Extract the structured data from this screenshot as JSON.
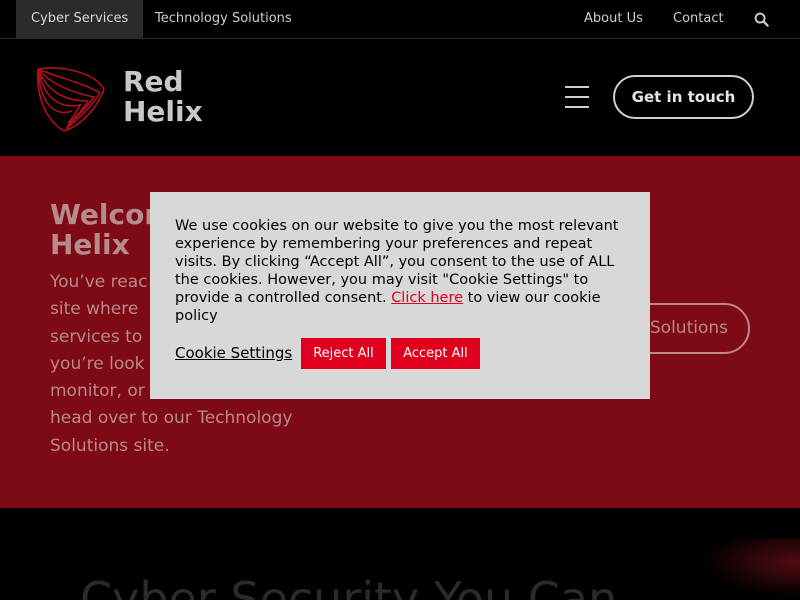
{
  "topbar": {
    "tab_cyber": "Cyber Services",
    "tab_tech": "Technology Solutions",
    "about": "About Us",
    "contact": "Contact",
    "search_icon": "search-icon"
  },
  "header": {
    "logo_line1": "Red",
    "logo_line2": "Helix",
    "menu_icon": "hamburger-menu-icon",
    "cta_label": "Get in touch"
  },
  "hero": {
    "title_line1": "Welcom",
    "title_line2": "Helix",
    "text": "You’ve reac\nsite where\nservices to\nyou’re look\nmonitor, or\nhead over to our Technology\nSolutions site.",
    "button_label": "Solutions"
  },
  "bottom": {
    "title": "Cyber Security You Can"
  },
  "cookie_modal": {
    "text_before_link": "We use cookies on our website to give you the most relevant experience by remembering your preferences and repeat visits. By clicking “Accept All”, you consent to the use of ALL the cookies. However, you may visit \"Cookie Settings\" to provide a controlled consent. ",
    "link_text": "Click here",
    "text_after_link": " to view our cookie policy",
    "settings_label": "Cookie Settings",
    "reject_label": "Reject All",
    "accept_label": "Accept All"
  },
  "colors": {
    "brand_red": "#e0001e",
    "hero_bg": "#7d0a14",
    "modal_bg": "#d8d8d8"
  }
}
